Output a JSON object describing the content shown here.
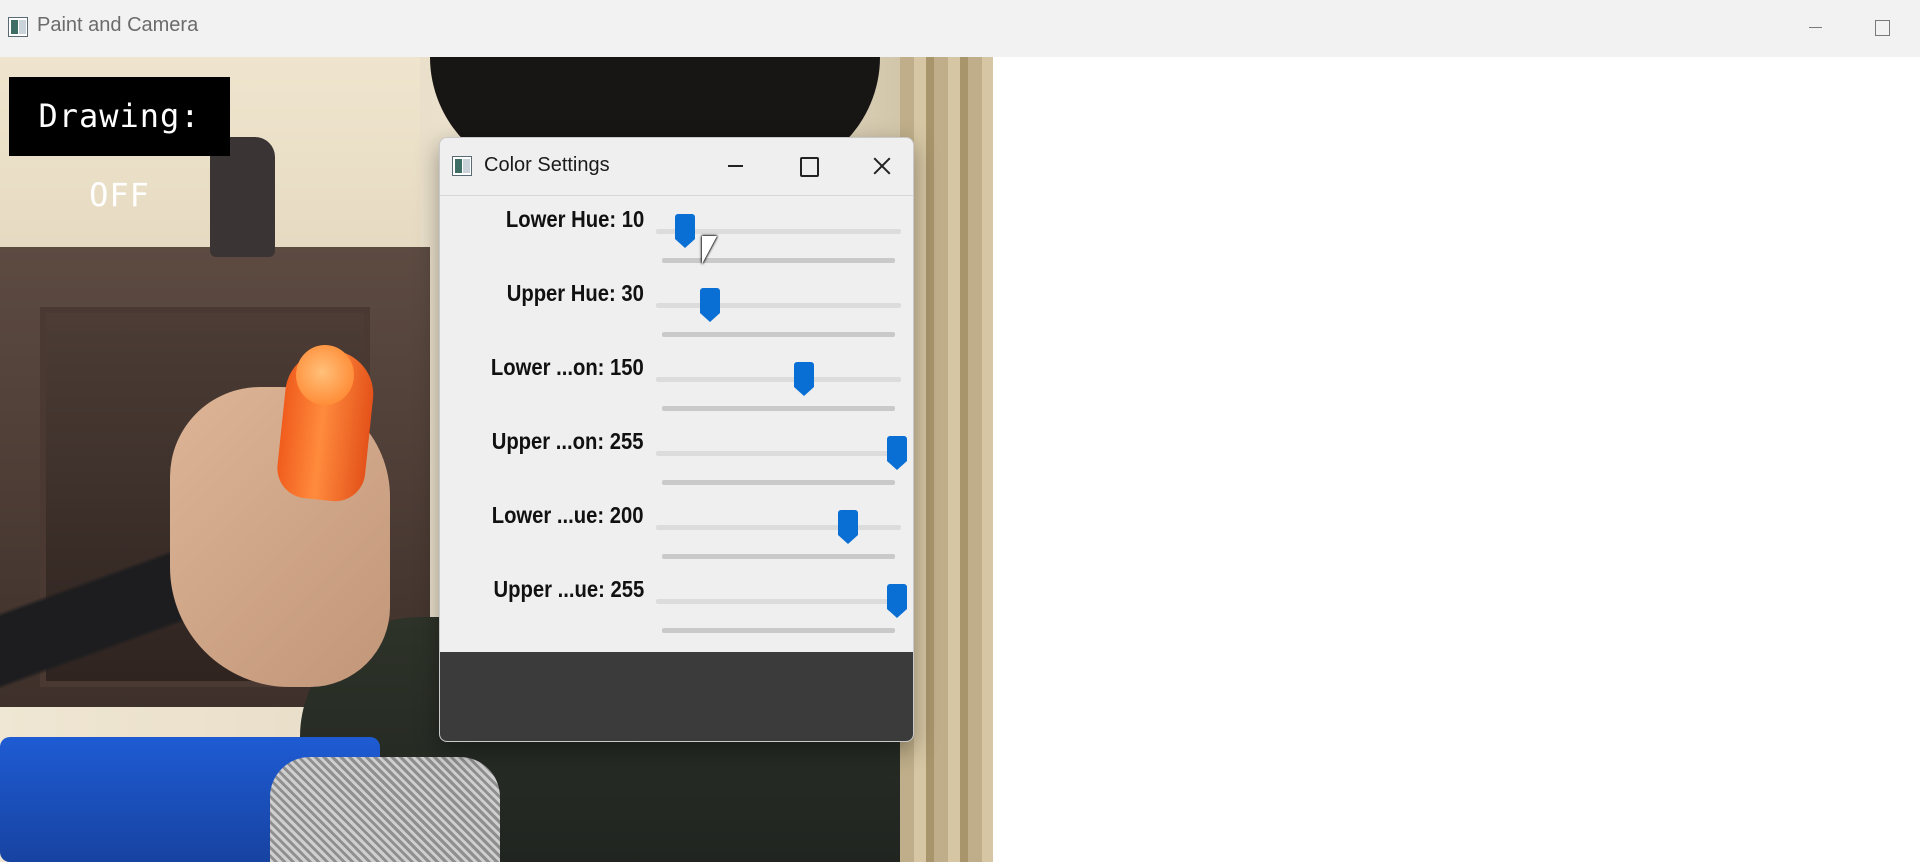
{
  "main_window": {
    "title": "Paint and Camera",
    "drawing_status": "Drawing: OFF"
  },
  "dialog": {
    "title": "Color Settings",
    "sliders": [
      {
        "label": "Lower Hue: 10",
        "value": 10,
        "max": 179
      },
      {
        "label": "Upper Hue: 30",
        "value": 30,
        "max": 179
      },
      {
        "label": "Lower ...on: 150",
        "value": 150,
        "max": 255
      },
      {
        "label": "Upper ...on: 255",
        "value": 255,
        "max": 255
      },
      {
        "label": "Lower ...ue: 200",
        "value": 200,
        "max": 255
      },
      {
        "label": "Upper ...ue: 255",
        "value": 255,
        "max": 255
      }
    ]
  },
  "colors": {
    "accent": "#0a6fd4",
    "status_bg": "#000000",
    "status_fg": "#ffffff"
  },
  "icons": {
    "app": "app-icon",
    "minimize": "minimize-icon",
    "maximize": "maximize-icon",
    "close": "close-icon",
    "cursor": "mouse-cursor-icon"
  }
}
